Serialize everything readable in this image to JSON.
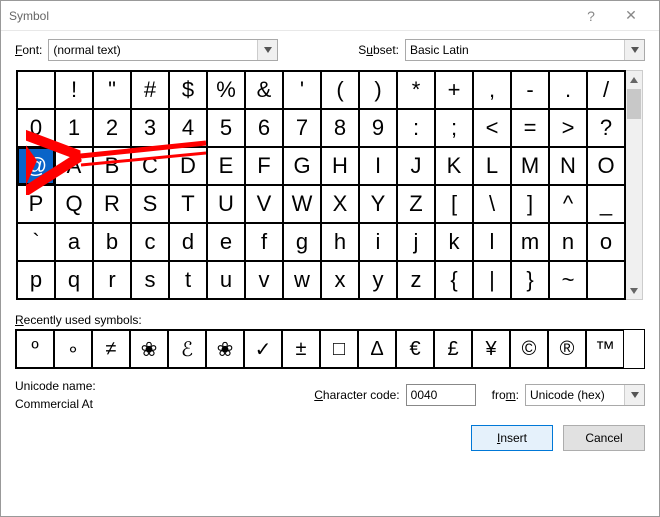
{
  "title": "Symbol",
  "help_glyph": "?",
  "close_glyph": "✕",
  "font_label": "Font:",
  "font_value": "(normal text)",
  "subset_label": "Subset:",
  "subset_value": "Basic Latin",
  "grid": [
    [
      " ",
      "!",
      "\"",
      "#",
      "$",
      "%",
      "&",
      "'",
      "(",
      ")",
      "*",
      "+",
      ",",
      "-",
      ".",
      "/"
    ],
    [
      "0",
      "1",
      "2",
      "3",
      "4",
      "5",
      "6",
      "7",
      "8",
      "9",
      ":",
      ";",
      "<",
      "=",
      ">",
      "?"
    ],
    [
      "@",
      "A",
      "B",
      "C",
      "D",
      "E",
      "F",
      "G",
      "H",
      "I",
      "J",
      "K",
      "L",
      "M",
      "N",
      "O"
    ],
    [
      "P",
      "Q",
      "R",
      "S",
      "T",
      "U",
      "V",
      "W",
      "X",
      "Y",
      "Z",
      "[",
      "\\",
      "]",
      "^",
      "_"
    ],
    [
      "`",
      "a",
      "b",
      "c",
      "d",
      "e",
      "f",
      "g",
      "h",
      "i",
      "j",
      "k",
      "l",
      "m",
      "n",
      "o"
    ],
    [
      "p",
      "q",
      "r",
      "s",
      "t",
      "u",
      "v",
      "w",
      "x",
      "y",
      "z",
      "{",
      "|",
      "}",
      "~",
      " "
    ]
  ],
  "selected_row": 2,
  "selected_col": 0,
  "recent_label": "Recently used symbols:",
  "recent": [
    "º",
    "∘",
    "≠",
    "❀",
    "ℰ",
    "❀",
    "✓",
    "±",
    "□",
    "Δ",
    "€",
    "£",
    "¥",
    "©",
    "®",
    "™"
  ],
  "unicode_name_label": "Unicode name:",
  "unicode_name_value": "Commercial At",
  "char_code_label": "Character code:",
  "char_code_value": "0040",
  "from_label": "from:",
  "from_value": "Unicode (hex)",
  "insert_label": "Insert",
  "cancel_label": "Cancel"
}
